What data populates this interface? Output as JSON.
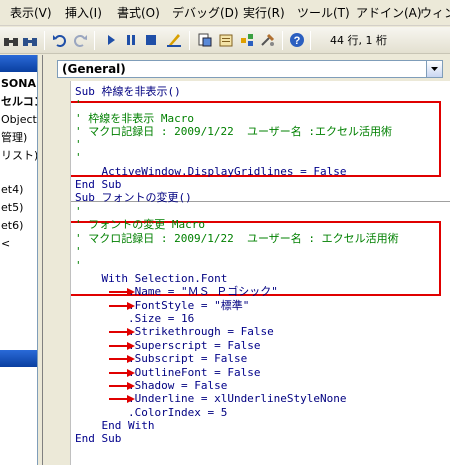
{
  "menu": {
    "items": [
      "表示(V)",
      "挿入(I)",
      "書式(O)",
      "デバッグ(D)",
      "実行(R)",
      "ツール(T)",
      "アドイン(A)",
      "ウィン"
    ]
  },
  "toolbar": {
    "icons": [
      "binoculars-icon",
      "undo-icon",
      "redo-icon",
      "run-icon",
      "pause-icon",
      "stop-icon",
      "design-mode-icon",
      "project-explorer-icon",
      "properties-icon",
      "object-browser-icon",
      "toolbox-icon",
      "help-icon"
    ],
    "position": "44 行, 1 桁"
  },
  "project": {
    "items": [
      "SONA",
      "セルコン",
      "Object",
      "管理)",
      "リスト)",
      "et4)",
      "et5)",
      "et6)",
      "<"
    ]
  },
  "code": {
    "procedure_combo": "(General)",
    "lines": [
      {
        "parts": [
          {
            "c": "kw",
            "t": "Sub "
          },
          {
            "c": "tx",
            "t": "枠線を非表示()"
          }
        ]
      },
      {
        "parts": [
          {
            "c": "cm",
            "t": "'"
          }
        ]
      },
      {
        "parts": [
          {
            "c": "cm",
            "t": "' 枠線を非表示 Macro"
          }
        ]
      },
      {
        "parts": [
          {
            "c": "cm",
            "t": "' マクロ記録日 : 2009/1/22  ユーザー名 :エクセル活用術"
          }
        ]
      },
      {
        "parts": [
          {
            "c": "cm",
            "t": "'"
          }
        ]
      },
      {
        "parts": [
          {
            "c": "cm",
            "t": "'"
          }
        ]
      },
      {
        "parts": [
          {
            "c": "tx",
            "t": "    ActiveWindow.DisplayGridlines = "
          },
          {
            "c": "kw",
            "t": "False"
          }
        ]
      },
      {
        "parts": [
          {
            "c": "kw",
            "t": "End Sub"
          }
        ]
      },
      {
        "parts": [
          {
            "c": "kw",
            "t": "Sub "
          },
          {
            "c": "tx",
            "t": "フォントの変更()"
          }
        ]
      },
      {
        "parts": [
          {
            "c": "cm",
            "t": "'"
          }
        ]
      },
      {
        "parts": [
          {
            "c": "cm",
            "t": "' フォントの変更 Macro"
          }
        ]
      },
      {
        "parts": [
          {
            "c": "cm",
            "t": "' マクロ記録日 : 2009/1/22  ユーザー名 : エクセル活用術"
          }
        ]
      },
      {
        "parts": [
          {
            "c": "cm",
            "t": "'"
          }
        ]
      },
      {
        "parts": [
          {
            "c": "cm",
            "t": "'"
          }
        ]
      },
      {
        "parts": [
          {
            "c": "kw",
            "t": "    With "
          },
          {
            "c": "tx",
            "t": "Selection.Font"
          }
        ]
      },
      {
        "parts": [
          {
            "c": "tx",
            "t": "        .Name = \"ＭＳ Ｐゴシック\""
          }
        ]
      },
      {
        "parts": [
          {
            "c": "tx",
            "t": "        .FontStyle = \"標準\""
          }
        ]
      },
      {
        "parts": [
          {
            "c": "tx",
            "t": "        .Size = 16"
          }
        ]
      },
      {
        "parts": [
          {
            "c": "tx",
            "t": "        .Strikethrough = "
          },
          {
            "c": "kw",
            "t": "False"
          }
        ]
      },
      {
        "parts": [
          {
            "c": "tx",
            "t": "        .Superscript = "
          },
          {
            "c": "kw",
            "t": "False"
          }
        ]
      },
      {
        "parts": [
          {
            "c": "tx",
            "t": "        .Subscript = "
          },
          {
            "c": "kw",
            "t": "False"
          }
        ]
      },
      {
        "parts": [
          {
            "c": "tx",
            "t": "        .OutlineFont = "
          },
          {
            "c": "kw",
            "t": "False"
          }
        ]
      },
      {
        "parts": [
          {
            "c": "tx",
            "t": "        .Shadow = "
          },
          {
            "c": "kw",
            "t": "False"
          }
        ]
      },
      {
        "parts": [
          {
            "c": "tx",
            "t": "        .Underline = xlUnderlineStyleNone"
          }
        ]
      },
      {
        "parts": [
          {
            "c": "tx",
            "t": "        .ColorIndex = 5"
          }
        ]
      },
      {
        "parts": [
          {
            "c": "kw",
            "t": "    End With"
          }
        ]
      },
      {
        "parts": [
          {
            "c": "kw",
            "t": "End Sub"
          }
        ]
      }
    ],
    "line_tops": [
      0,
      13,
      27,
      40,
      53,
      66,
      80,
      93,
      106,
      120,
      133,
      147,
      160,
      174,
      187,
      200,
      214,
      227,
      240,
      254,
      267,
      281,
      294,
      307,
      321,
      334,
      347
    ]
  },
  "colors": {
    "keyword": "#00008b",
    "comment": "#008000",
    "text": "#000080",
    "highlight": "#e00000"
  }
}
